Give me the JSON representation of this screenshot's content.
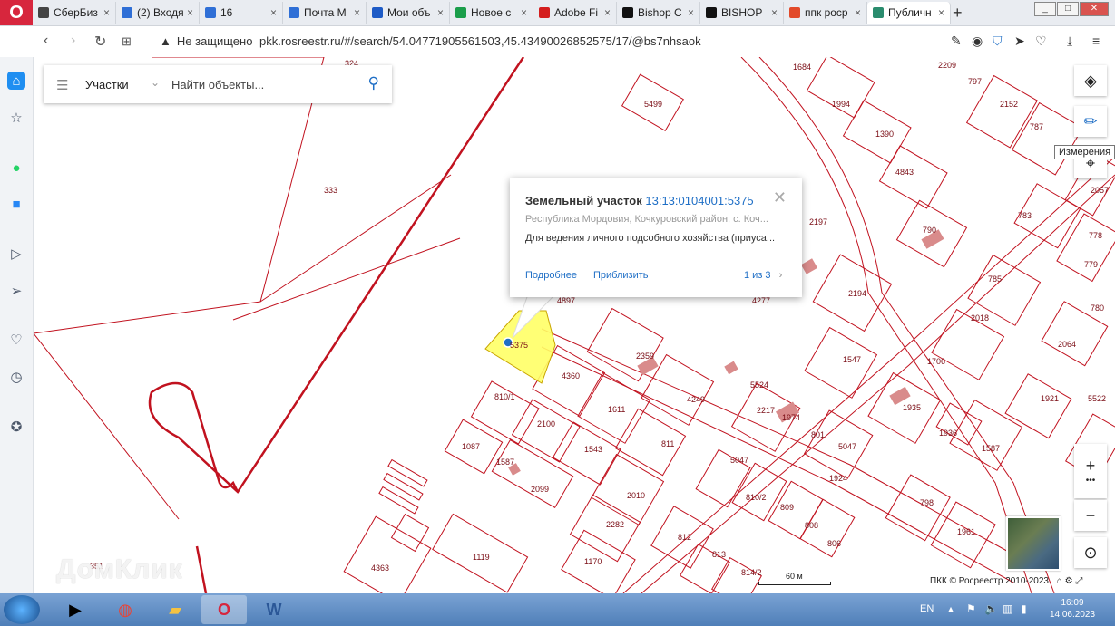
{
  "browser": {
    "tabs": [
      {
        "label": "СберБиз",
        "color": "#444"
      },
      {
        "label": "(2) Входя",
        "color": "#2f6fd6"
      },
      {
        "label": "16",
        "color": "#2f6fd6"
      },
      {
        "label": "Почта М",
        "color": "#2f6fd6"
      },
      {
        "label": "Мои объ",
        "color": "#1e5bc6"
      },
      {
        "label": "Новое с",
        "color": "#1b9e4b"
      },
      {
        "label": "Adobe Fi",
        "color": "#d41e1e"
      },
      {
        "label": "Bishop C",
        "color": "#111"
      },
      {
        "label": "BISHOP",
        "color": "#111"
      },
      {
        "label": "ппк роср",
        "color": "#e24a2a"
      },
      {
        "label": "Публичн",
        "color": "#2a8c6e"
      }
    ],
    "new_tab": "+",
    "address": {
      "security": "Не защищено",
      "url": "pkk.rosreestr.ru/#/search/54.04771905561503,45.43490026852575/17/@bs7nhsaok"
    }
  },
  "search": {
    "mode": "Участки",
    "placeholder": "Найти объекты..."
  },
  "popup": {
    "title": "Земельный участок",
    "cadastral": "13:13:0104001:5375",
    "address": "Республика Мордовия, Кочкуровский район, с. Коч...",
    "use": "Для ведения личного подсобного хозяйства (приуса...",
    "more_link": "Подробнее",
    "zoom_link": "Приблизить",
    "pager": "1 из 3"
  },
  "map_controls": {
    "tooltip": "Измерения",
    "zoom_in": "+",
    "zoom_out": "−",
    "more": "•••"
  },
  "scale": {
    "label": "60 м"
  },
  "copyright": "ПКК © Росреестр 2010-2023",
  "watermark": "ДомКлик",
  "parcel_labels": [
    "324",
    "333",
    "351",
    "5499",
    "1684",
    "1994",
    "2209",
    "797",
    "2152",
    "787",
    "1390",
    "4843",
    "2057",
    "783",
    "778",
    "790",
    "779",
    "2197",
    "4897",
    "5375",
    "4277",
    "785",
    "780",
    "2194",
    "2018",
    "2359",
    "4360",
    "1547",
    "1706",
    "2064",
    "810/1",
    "2100",
    "1611",
    "4249",
    "5524",
    "2217",
    "1974",
    "801",
    "5047",
    "1935",
    "1936",
    "1921",
    "5522",
    "1087",
    "1587",
    "2099",
    "1543",
    "811",
    "5047",
    "1924",
    "1587",
    "2010",
    "810/2",
    "809",
    "808",
    "798",
    "1961",
    "2282",
    "812",
    "806",
    "4363",
    "1119",
    "1170",
    "813",
    "814/2"
  ],
  "taskbar": {
    "lang": "EN",
    "time": "16:09",
    "date": "14.06.2023"
  }
}
